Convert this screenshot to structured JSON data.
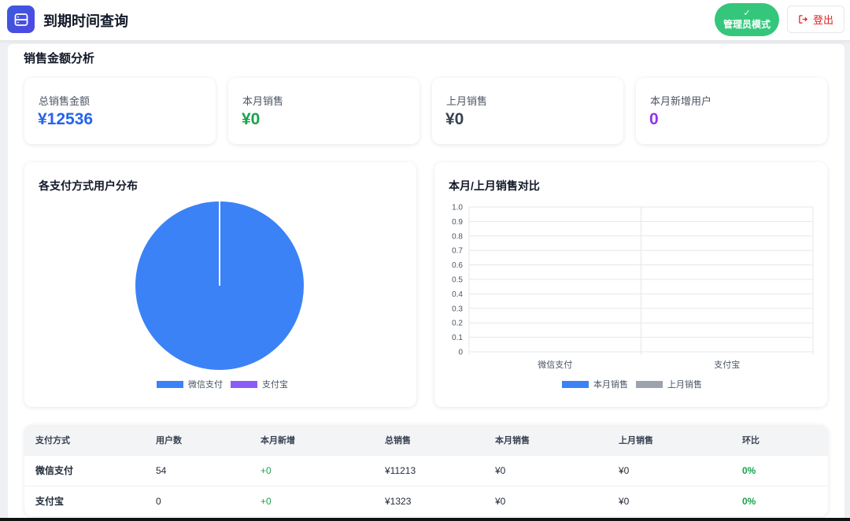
{
  "header": {
    "title": "到期时间查询",
    "admin_badge": "管理员模式",
    "admin_check": "✓",
    "logout_label": "登出"
  },
  "section": {
    "title": "销售金额分析"
  },
  "stats": [
    {
      "label": "总销售金额",
      "value": "¥12536",
      "color": "#2563eb"
    },
    {
      "label": "本月销售",
      "value": "¥0",
      "color": "#16a34a"
    },
    {
      "label": "上月销售",
      "value": "¥0",
      "color": "#374151"
    },
    {
      "label": "本月新增用户",
      "value": "0",
      "color": "#9333ea"
    }
  ],
  "pie_chart": {
    "title": "各支付方式用户分布",
    "chart_data": {
      "type": "pie",
      "categories": [
        "微信支付",
        "支付宝"
      ],
      "values": [
        54,
        0
      ],
      "colors": [
        "#3b82f6",
        "#8b5cf6"
      ],
      "legend_position": "bottom"
    }
  },
  "bar_chart": {
    "title": "本月/上月销售对比",
    "chart_data": {
      "type": "bar",
      "categories": [
        "微信支付",
        "支付宝"
      ],
      "series": [
        {
          "name": "本月销售",
          "values": [
            0,
            0
          ],
          "color": "#3b82f6"
        },
        {
          "name": "上月销售",
          "values": [
            0,
            0
          ],
          "color": "#9ca3af"
        }
      ],
      "ylim": [
        0,
        1.0
      ],
      "y_ticks": [
        "1.0",
        "0.9",
        "0.8",
        "0.7",
        "0.6",
        "0.5",
        "0.4",
        "0.3",
        "0.2",
        "0.1",
        "0"
      ],
      "grid": true,
      "legend_position": "bottom"
    }
  },
  "table": {
    "headers": [
      "支付方式",
      "用户数",
      "本月新增",
      "总销售",
      "本月销售",
      "上月销售",
      "环比"
    ],
    "rows": [
      [
        "微信支付",
        "54",
        "+0",
        "¥11213",
        "¥0",
        "¥0",
        "0%"
      ],
      [
        "支付宝",
        "0",
        "+0",
        "¥1323",
        "¥0",
        "¥0",
        "0%"
      ]
    ]
  }
}
